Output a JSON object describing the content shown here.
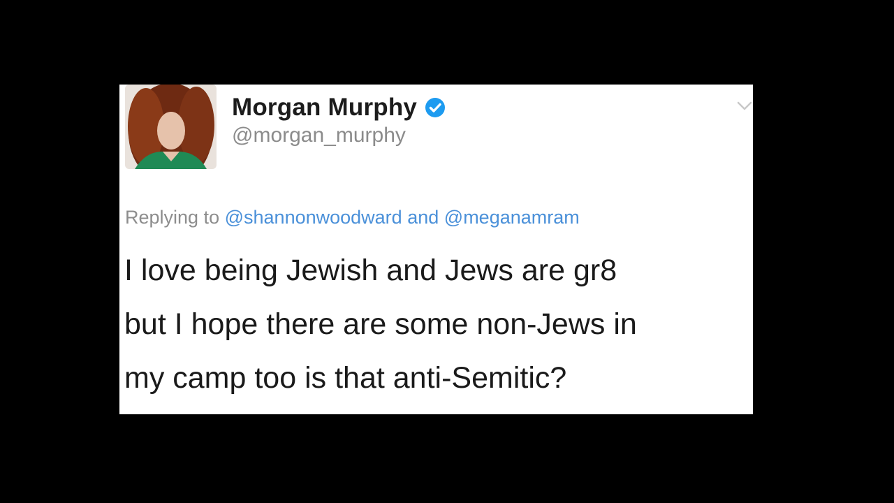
{
  "tweet": {
    "author": {
      "display_name": "Morgan Murphy",
      "handle": "@morgan_murphy",
      "verified": true
    },
    "reply_context": {
      "prefix": "Replying to",
      "mention_1": "@shannonwoodward",
      "joiner": "and",
      "mention_2": "@meganamram"
    },
    "text_lines": [
      "I love being Jewish and Jews are gr8",
      "but I hope there are some non-Jews in",
      "my camp too is that anti-Semitic?"
    ]
  },
  "icons": {
    "verified": "verified-badge-icon",
    "menu": "chevron-down-icon"
  },
  "colors": {
    "background": "#000000",
    "card": "#ffffff",
    "verified_blue": "#1d9bf0",
    "mention_blue": "#4a90d9",
    "secondary_text": "#8b8b8b"
  }
}
